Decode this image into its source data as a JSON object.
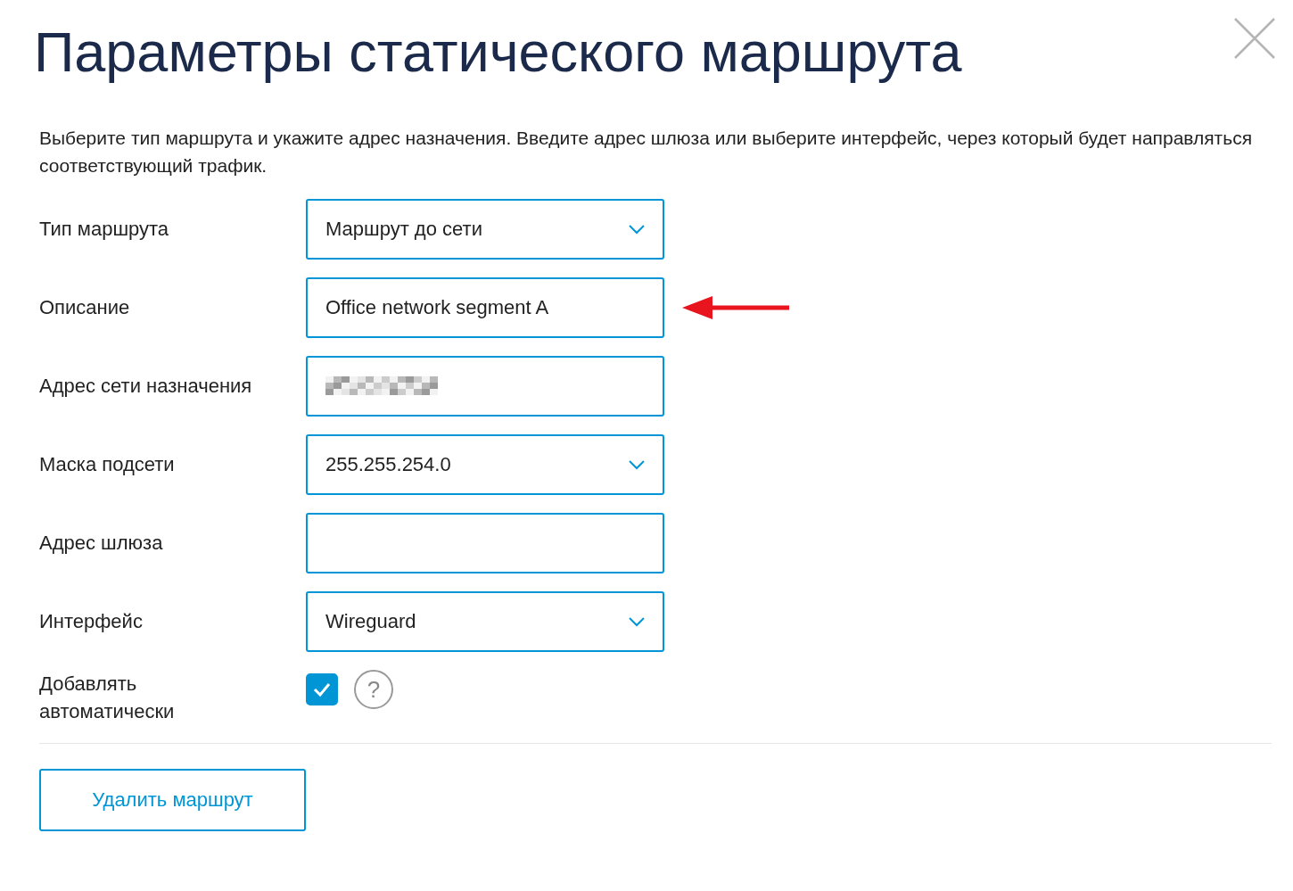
{
  "title": "Параметры статического маршрута",
  "description": "Выберите тип маршрута и укажите адрес назначения. Введите адрес шлюза или выберите интерфейс, через который будет направляться соответствующий трафик.",
  "fields": [
    {
      "label": "Тип маршрута",
      "kind": "select",
      "value": "Маршрут до сети",
      "pointer": false
    },
    {
      "label": "Описание",
      "kind": "text",
      "value": "Office network segment A",
      "pointer": true
    },
    {
      "label": "Адрес сети назначения",
      "kind": "redacted",
      "pointer": false
    },
    {
      "label": "Маска подсети",
      "kind": "select",
      "value": "255.255.254.0",
      "pointer": false
    },
    {
      "label": "Адрес шлюза",
      "kind": "text",
      "pointer": false
    },
    {
      "label": "Интерфейс",
      "kind": "select",
      "value": "Wireguard",
      "pointer": false
    }
  ],
  "auto_add": {
    "label": "Добавлять автоматически",
    "checked": true,
    "help": "?"
  },
  "delete_button": "Удалить маршрут"
}
